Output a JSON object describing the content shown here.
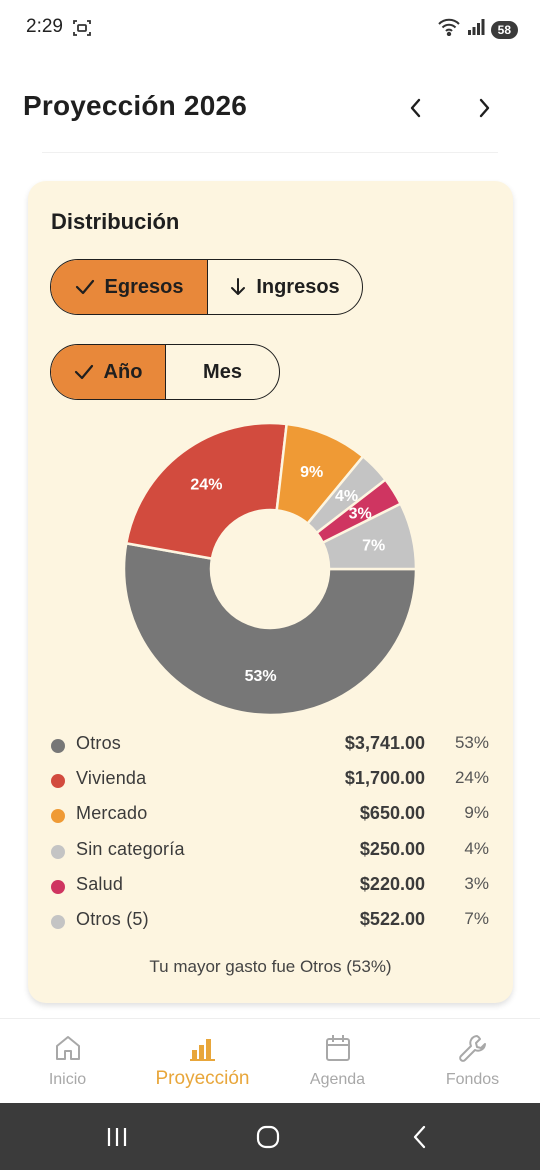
{
  "status_bar": {
    "time": "2:29",
    "battery": "58"
  },
  "header": {
    "title": "Proyección 2026",
    "prev_icon": "chevron-left-icon",
    "next_icon": "chevron-right-icon"
  },
  "card": {
    "title": "Distribución",
    "type_toggle": {
      "egresos": "Egresos",
      "ingresos": "Ingresos"
    },
    "period_toggle": {
      "anio": "Año",
      "mes": "Mes"
    },
    "legend": [
      {
        "name": "Otros",
        "amount": "$3,741.00",
        "pct": "53%",
        "color": "#777777"
      },
      {
        "name": "Vivienda",
        "amount": "$1,700.00",
        "pct": "24%",
        "color": "#d24b3e"
      },
      {
        "name": "Mercado",
        "amount": "$650.00",
        "pct": "9%",
        "color": "#ef9a35"
      },
      {
        "name": "Sin categoría",
        "amount": "$250.00",
        "pct": "4%",
        "color": "#c4c4c4"
      },
      {
        "name": "Salud",
        "amount": "$220.00",
        "pct": "3%",
        "color": "#cf3561"
      },
      {
        "name": "Otros (5)",
        "amount": "$522.00",
        "pct": "7%",
        "color": "#c4c4c4"
      }
    ],
    "summary": "Tu mayor gasto fue Otros (53%)"
  },
  "chart_data": {
    "type": "pie",
    "donut": true,
    "categories": [
      "Otros",
      "Vivienda",
      "Mercado",
      "Sin categoría",
      "Salud",
      "Otros (5)"
    ],
    "values": [
      3741,
      1700,
      650,
      250,
      220,
      522
    ],
    "labels": [
      "53%",
      "24%",
      "9%",
      "4%",
      "3%",
      "7%"
    ],
    "colors": [
      "#777777",
      "#d24b3e",
      "#ef9a35",
      "#c4c4c4",
      "#cf3561",
      "#c4c4c4"
    ]
  },
  "bottom_nav": [
    {
      "label": "Inicio",
      "icon": "home-icon",
      "active": false
    },
    {
      "label": "Proyección",
      "icon": "bar-chart-icon",
      "active": true
    },
    {
      "label": "Agenda",
      "icon": "calendar-icon",
      "active": false
    },
    {
      "label": "Fondos",
      "icon": "wrench-icon",
      "active": false
    }
  ],
  "colors": {
    "accent": "#e8883a",
    "active_nav": "#e8a63a",
    "card_bg": "#fdf5e0"
  }
}
